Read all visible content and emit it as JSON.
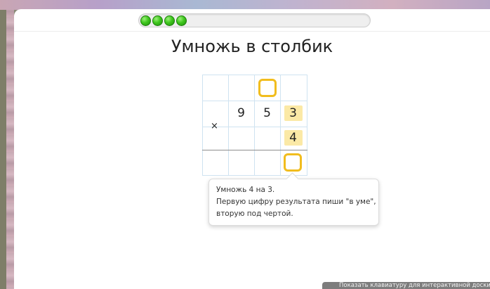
{
  "progress": {
    "filled_steps": 4
  },
  "title": "Умножь в столбик",
  "problem": {
    "operator": "×",
    "multiplicand_digits": [
      "9",
      "5",
      "3"
    ],
    "multiplier_digits": [
      "4"
    ],
    "highlighted_digits": [
      "3",
      "4"
    ]
  },
  "hint": {
    "line1": "Умножь 4 на 3.",
    "line2": "Первую цифру результата пиши \"в уме\",",
    "line3": "вторую под чертой."
  },
  "keyboard_button": {
    "label": "Показать клавиатуру для интерактивной доски"
  },
  "colors": {
    "progress_green": "#3fc71e",
    "highlight_yellow": "#fbe9a6",
    "slot_border": "#f1bd1e",
    "grid_line": "#cfe3f1"
  }
}
